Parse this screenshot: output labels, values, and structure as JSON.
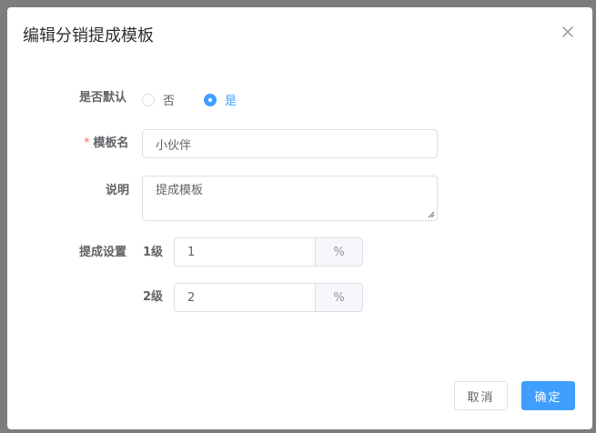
{
  "dialog": {
    "title": "编辑分销提成模板",
    "close_icon": "close-icon"
  },
  "form": {
    "default": {
      "label": "是否默认",
      "options": [
        {
          "label": "否",
          "checked": false
        },
        {
          "label": "是",
          "checked": true
        }
      ]
    },
    "template_name": {
      "required_mark": "*",
      "label": "模板名",
      "value": "小伙伴"
    },
    "description": {
      "label": "说明",
      "value": "提成模板"
    },
    "commission": {
      "label": "提成设置",
      "tiers": [
        {
          "label": "1级",
          "value": "1",
          "unit": "%"
        },
        {
          "label": "2级",
          "value": "2",
          "unit": "%"
        }
      ]
    }
  },
  "footer": {
    "cancel_label": "取消",
    "confirm_label": "确定"
  },
  "colors": {
    "primary": "#409eff",
    "required": "#f56c6c",
    "overlay": "#7d7d7d"
  }
}
